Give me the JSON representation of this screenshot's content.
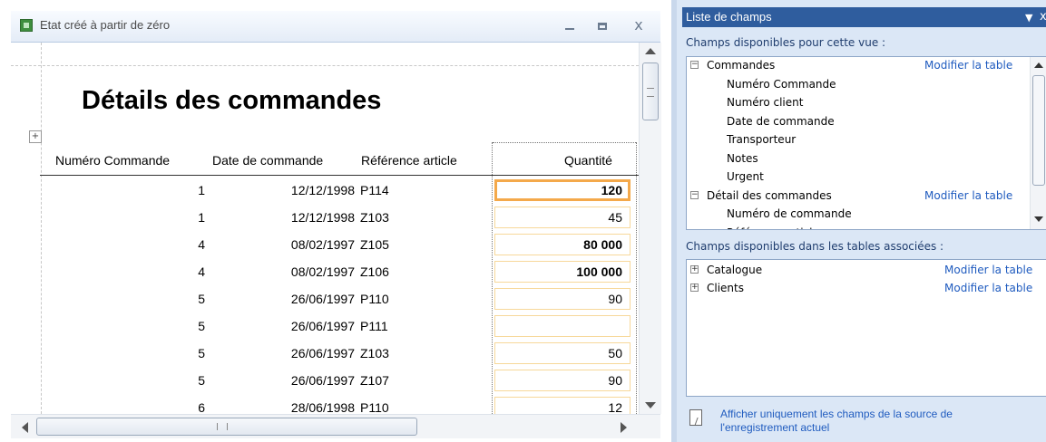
{
  "report_window": {
    "title": "Etat créé à partir de zéro",
    "close_glyph": "x",
    "report_title": "Détails des commandes",
    "layout_handle_glyph": "+",
    "columns": [
      "Numéro Commande",
      "Date de commande",
      "Référence article",
      "Quantité"
    ],
    "rows": [
      {
        "num": "1",
        "date": "12/12/1998",
        "ref": "P114",
        "qty": "120",
        "bold": true,
        "selected": true
      },
      {
        "num": "1",
        "date": "12/12/1998",
        "ref": "Z103",
        "qty": "45"
      },
      {
        "num": "4",
        "date": "08/02/1997",
        "ref": "Z105",
        "qty": "80 000",
        "bold": true
      },
      {
        "num": "4",
        "date": "08/02/1997",
        "ref": "Z106",
        "qty": "100 000",
        "bold": true
      },
      {
        "num": "5",
        "date": "26/06/1997",
        "ref": "P110",
        "qty": "90"
      },
      {
        "num": "5",
        "date": "26/06/1997",
        "ref": "P111",
        "qty": ""
      },
      {
        "num": "5",
        "date": "26/06/1997",
        "ref": "Z103",
        "qty": "50"
      },
      {
        "num": "5",
        "date": "26/06/1997",
        "ref": "Z107",
        "qty": "90"
      },
      {
        "num": "6",
        "date": "28/06/1998",
        "ref": "P110",
        "qty": "12"
      }
    ],
    "hscroll_grip": "III"
  },
  "field_list": {
    "title": "Liste de champs",
    "dropdown_glyph": "▼",
    "close_glyph": "x",
    "available_label": "Champs disponibles pour cette vue :",
    "modify_label": "Modifier la table",
    "tables": [
      {
        "name": "Commandes",
        "expander": "−",
        "fields": [
          "Numéro Commande",
          "Numéro client",
          "Date de commande",
          "Transporteur",
          "Notes",
          "Urgent"
        ]
      },
      {
        "name": "Détail des commandes",
        "expander": "−",
        "fields": [
          "Numéro de commande",
          "Référence article"
        ]
      }
    ],
    "related_label": "Champs disponibles dans les tables associées :",
    "related_tables": [
      {
        "name": "Catalogue",
        "expander": "+"
      },
      {
        "name": "Clients",
        "expander": "+"
      }
    ],
    "footer_link": "Afficher uniquement les champs de la source de l'enregistrement actuel"
  }
}
